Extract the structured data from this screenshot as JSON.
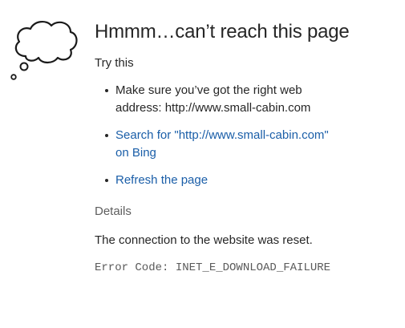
{
  "page": {
    "cloud_icon": "thought-cloud-icon",
    "title": "Hmmm…can’t reach this page",
    "try_this": "Try this",
    "suggestions": {
      "address_line1": "Make sure you’ve got the right web",
      "address_line2": "address: http://www.small-cabin.com",
      "search_line1": "Search for \"http://www.small-cabin.com\"",
      "search_line2": "on Bing",
      "refresh": "Refresh the page"
    },
    "details_heading": "Details",
    "reason": "The connection to the website was reset.",
    "error_code": "Error Code: INET_E_DOWNLOAD_FAILURE"
  },
  "colors": {
    "link": "#1a5ea8",
    "text": "#262626",
    "muted": "#5e5e5e"
  }
}
